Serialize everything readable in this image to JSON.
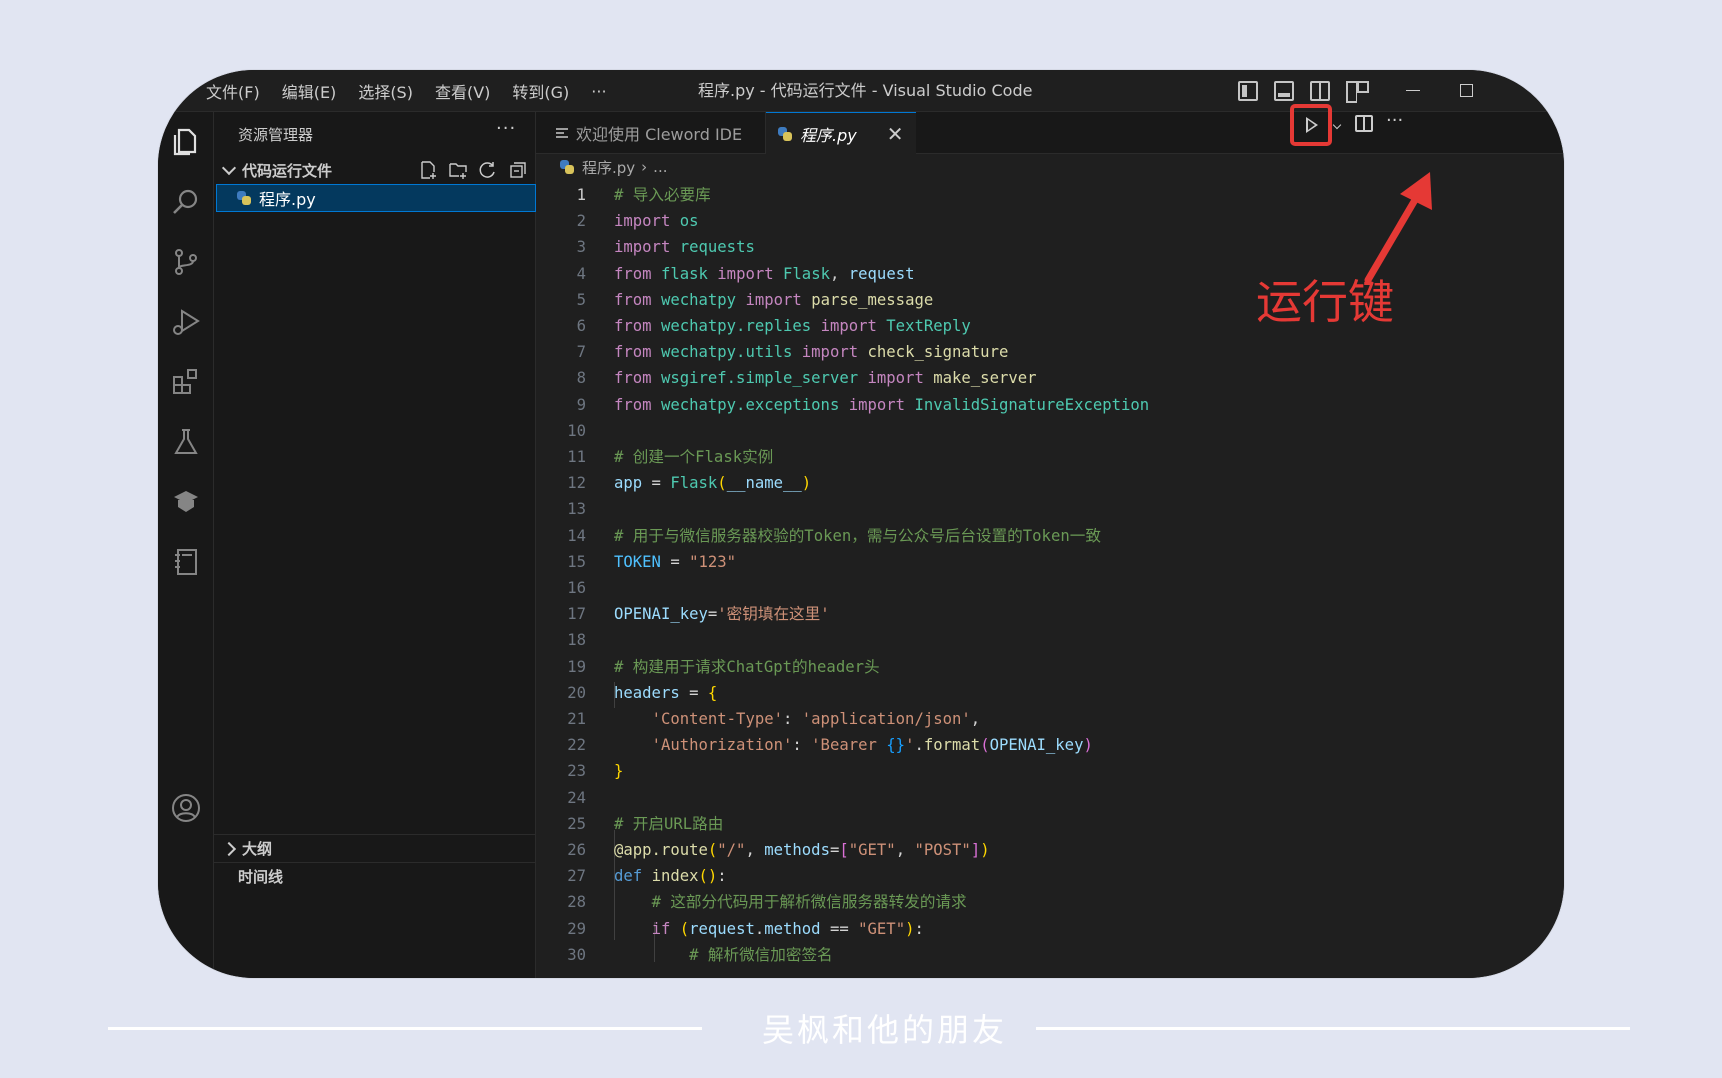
{
  "titlebar": {
    "menu": [
      "文件(F)",
      "编辑(E)",
      "选择(S)",
      "查看(V)",
      "转到(G)",
      "···"
    ],
    "title": "程序.py - 代码运行文件 - Visual Studio Code"
  },
  "sidebar": {
    "header": "资源管理器",
    "more": "···",
    "folder": "代码运行文件",
    "file": "程序.py",
    "outline": "大纲",
    "timeline": "时间线"
  },
  "tabs": {
    "welcome": "欢迎使用 Cleword IDE",
    "active": "程序.py",
    "close": "✕",
    "more": "···"
  },
  "breadcrumb": {
    "file": "程序.py",
    "sep": "›",
    "rest": "..."
  },
  "annotation": {
    "label": "运行键"
  },
  "footer": {
    "text": "吴枫和他的朋友"
  },
  "code": {
    "active_line": 1,
    "lines": [
      [
        [
          "cmt",
          "# 导入必要库"
        ]
      ],
      [
        [
          "kw",
          "import"
        ],
        [
          "",
          " "
        ],
        [
          "mod",
          "os"
        ]
      ],
      [
        [
          "kw",
          "import"
        ],
        [
          "",
          " "
        ],
        [
          "mod",
          "requests"
        ]
      ],
      [
        [
          "kw",
          "from"
        ],
        [
          "",
          " "
        ],
        [
          "mod",
          "flask"
        ],
        [
          "",
          " "
        ],
        [
          "kw",
          "import"
        ],
        [
          "",
          " "
        ],
        [
          "mod",
          "Flask"
        ],
        [
          "",
          ", "
        ],
        [
          "var",
          "request"
        ]
      ],
      [
        [
          "kw",
          "from"
        ],
        [
          "",
          " "
        ],
        [
          "mod",
          "wechatpy"
        ],
        [
          "",
          " "
        ],
        [
          "kw",
          "import"
        ],
        [
          "",
          " "
        ],
        [
          "fn",
          "parse_message"
        ]
      ],
      [
        [
          "kw",
          "from"
        ],
        [
          "",
          " "
        ],
        [
          "mod",
          "wechatpy.replies"
        ],
        [
          "",
          " "
        ],
        [
          "kw",
          "import"
        ],
        [
          "",
          " "
        ],
        [
          "mod",
          "TextReply"
        ]
      ],
      [
        [
          "kw",
          "from"
        ],
        [
          "",
          " "
        ],
        [
          "mod",
          "wechatpy.utils"
        ],
        [
          "",
          " "
        ],
        [
          "kw",
          "import"
        ],
        [
          "",
          " "
        ],
        [
          "fn",
          "check_signature"
        ]
      ],
      [
        [
          "kw",
          "from"
        ],
        [
          "",
          " "
        ],
        [
          "mod",
          "wsgiref.simple_server"
        ],
        [
          "",
          " "
        ],
        [
          "kw",
          "import"
        ],
        [
          "",
          " "
        ],
        [
          "fn",
          "make_server"
        ]
      ],
      [
        [
          "kw",
          "from"
        ],
        [
          "",
          " "
        ],
        [
          "mod",
          "wechatpy.exceptions"
        ],
        [
          "",
          " "
        ],
        [
          "kw",
          "import"
        ],
        [
          "",
          " "
        ],
        [
          "mod",
          "InvalidSignatureException"
        ]
      ],
      [],
      [
        [
          "cmt",
          "# 创建一个Flask实例"
        ]
      ],
      [
        [
          "var",
          "app"
        ],
        [
          "op",
          " = "
        ],
        [
          "mod",
          "Flask"
        ],
        [
          "br1",
          "("
        ],
        [
          "var",
          "__name__"
        ],
        [
          "br1",
          ")"
        ]
      ],
      [],
      [
        [
          "cmt",
          "# 用于与微信服务器校验的Token，需与公众号后台设置的Token一致"
        ]
      ],
      [
        [
          "const",
          "TOKEN"
        ],
        [
          "op",
          " = "
        ],
        [
          "str",
          "\"123\""
        ]
      ],
      [],
      [
        [
          "var",
          "OPENAI_key"
        ],
        [
          "op",
          "="
        ],
        [
          "str",
          "'密钥填在这里'"
        ]
      ],
      [],
      [
        [
          "cmt",
          "# 构建用于请求ChatGpt的header头"
        ]
      ],
      [
        [
          "var",
          "headers"
        ],
        [
          "op",
          " = "
        ],
        [
          "br1",
          "{"
        ]
      ],
      [
        [
          "",
          "    "
        ],
        [
          "str",
          "'Content-Type'"
        ],
        [
          "op",
          ": "
        ],
        [
          "str",
          "'application/json'"
        ],
        [
          "op",
          ","
        ]
      ],
      [
        [
          "",
          "    "
        ],
        [
          "str",
          "'Authorization'"
        ],
        [
          "op",
          ": "
        ],
        [
          "str",
          "'Bearer "
        ],
        [
          "br3",
          "{}"
        ],
        [
          "str",
          "'"
        ],
        [
          "op",
          "."
        ],
        [
          "fn",
          "format"
        ],
        [
          "br2",
          "("
        ],
        [
          "var",
          "OPENAI_key"
        ],
        [
          "br2",
          ")"
        ]
      ],
      [
        [
          "br1",
          "}"
        ]
      ],
      [],
      [
        [
          "cmt",
          "# 开启URL路由"
        ]
      ],
      [
        [
          "fn",
          "@app.route"
        ],
        [
          "br1",
          "("
        ],
        [
          "str",
          "\"/\""
        ],
        [
          "op",
          ", "
        ],
        [
          "var",
          "methods"
        ],
        [
          "op",
          "="
        ],
        [
          "br2",
          "["
        ],
        [
          "str",
          "\"GET\""
        ],
        [
          "op",
          ", "
        ],
        [
          "str",
          "\"POST\""
        ],
        [
          "br2",
          "]"
        ],
        [
          "br1",
          ")"
        ]
      ],
      [
        [
          "blue",
          "def"
        ],
        [
          "",
          " "
        ],
        [
          "fn",
          "index"
        ],
        [
          "br1",
          "()"
        ],
        [
          "op",
          ":"
        ]
      ],
      [
        [
          "",
          "    "
        ],
        [
          "cmt",
          "# 这部分代码用于解析微信服务器转发的请求"
        ]
      ],
      [
        [
          "",
          "    "
        ],
        [
          "kw",
          "if"
        ],
        [
          "",
          " "
        ],
        [
          "br1",
          "("
        ],
        [
          "var",
          "request"
        ],
        [
          "op",
          "."
        ],
        [
          "var",
          "method"
        ],
        [
          "op",
          " == "
        ],
        [
          "str",
          "\"GET\""
        ],
        [
          "br1",
          ")"
        ],
        [
          "op",
          ":"
        ]
      ],
      [
        [
          "",
          "        "
        ],
        [
          "cmt",
          "# 解析微信加密签名"
        ]
      ]
    ]
  }
}
